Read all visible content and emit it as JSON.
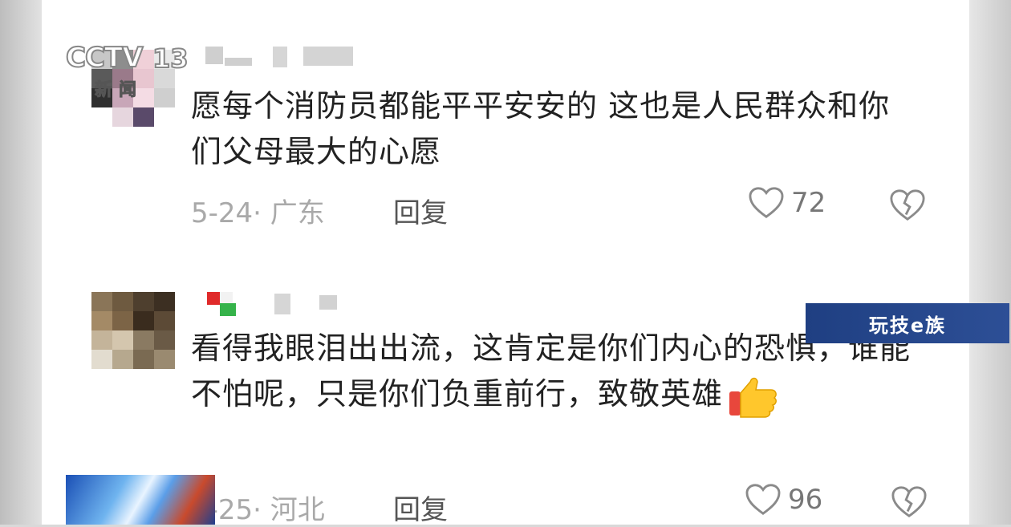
{
  "broadcaster": {
    "logo_text": "CCTV",
    "channel_number": "13",
    "subtitle": "新闻"
  },
  "watermark": {
    "text": "玩技e族"
  },
  "comments": [
    {
      "text": "愿每个消防员都能平平安安的 这也是人民群众和你们父母最大的心愿",
      "meta": "5-24· 广东",
      "reply_label": "回复",
      "like_count": "72"
    },
    {
      "text": "看得我眼泪出出流，这肯定是你们内心的恐惧，谁能不怕呢，只是你们负重前行，致敬英雄",
      "meta": "5-25· 河北",
      "reply_label": "回复",
      "like_count": "96"
    }
  ],
  "icons": {
    "like": "heart-outline-icon",
    "dislike": "broken-heart-icon",
    "emoji": "thumbs-up-emoji"
  }
}
